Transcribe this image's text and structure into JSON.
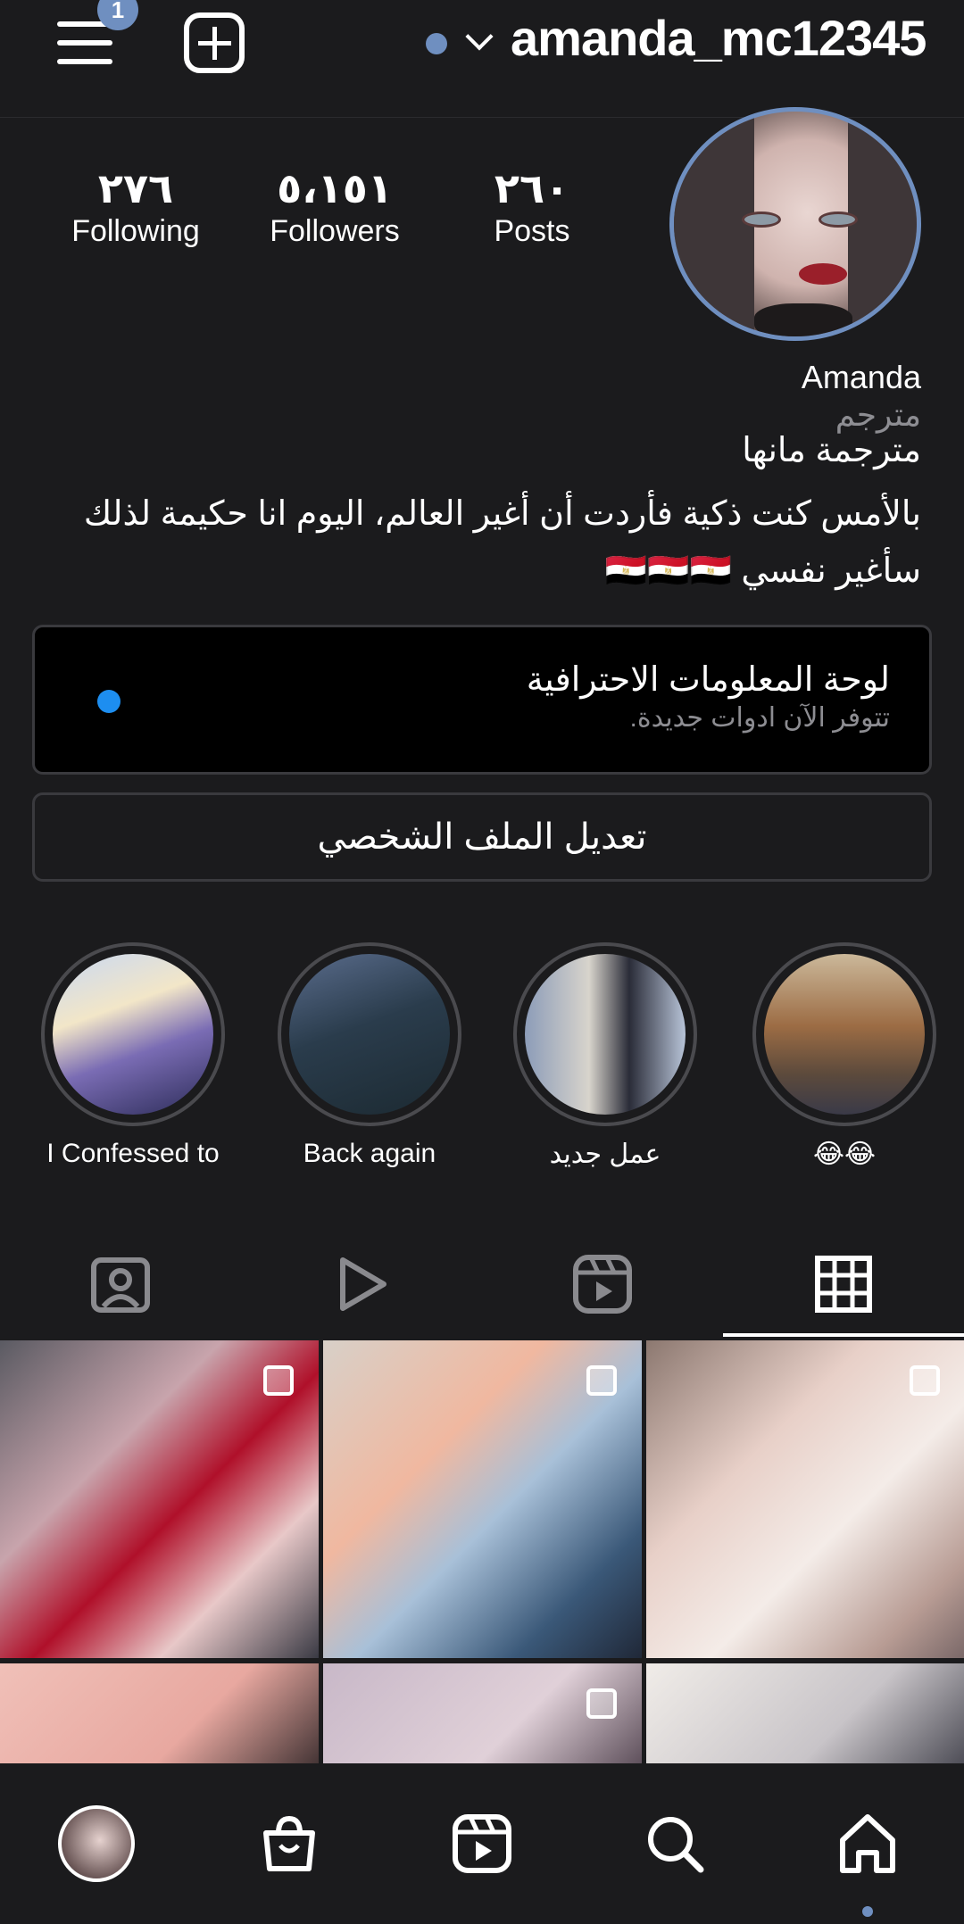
{
  "header": {
    "username": "amanda_mc12345",
    "menu_badge": "1"
  },
  "profile": {
    "stats": [
      {
        "num": "٢٧٦",
        "label": "Following"
      },
      {
        "num": "٥،١٥١",
        "label": "Followers"
      },
      {
        "num": "٢٦٠",
        "label": "Posts"
      }
    ],
    "name": "Amanda",
    "category": "مترجم",
    "bio_line1": "مترجمة مانها",
    "bio_line2": "بالأمس كنت ذكية فأردت أن أغير العالم، اليوم انا حكيمة لذلك سأغير نفسي 🇪🇬🇪🇬🇪🇬"
  },
  "dashboard": {
    "title": "لوحة المعلومات الاحترافية",
    "subtitle": "تتوفر الآن ادوات جديدة."
  },
  "edit_profile_label": "تعديل الملف الشخصي",
  "highlights": [
    {
      "label": "I Confessed to"
    },
    {
      "label": "Back again"
    },
    {
      "label": "عمل جديد"
    },
    {
      "label": "😂😂"
    }
  ],
  "tabs": [
    "tagged-icon",
    "play-icon",
    "reels-icon",
    "grid-icon"
  ],
  "bottom_nav": [
    "profile-avatar",
    "shop-icon",
    "reels-icon",
    "search-icon",
    "home-icon"
  ],
  "colors": {
    "background": "#1b1b1d",
    "accent": "#6f8fc0",
    "notification_dot": "#1d8ef0"
  }
}
